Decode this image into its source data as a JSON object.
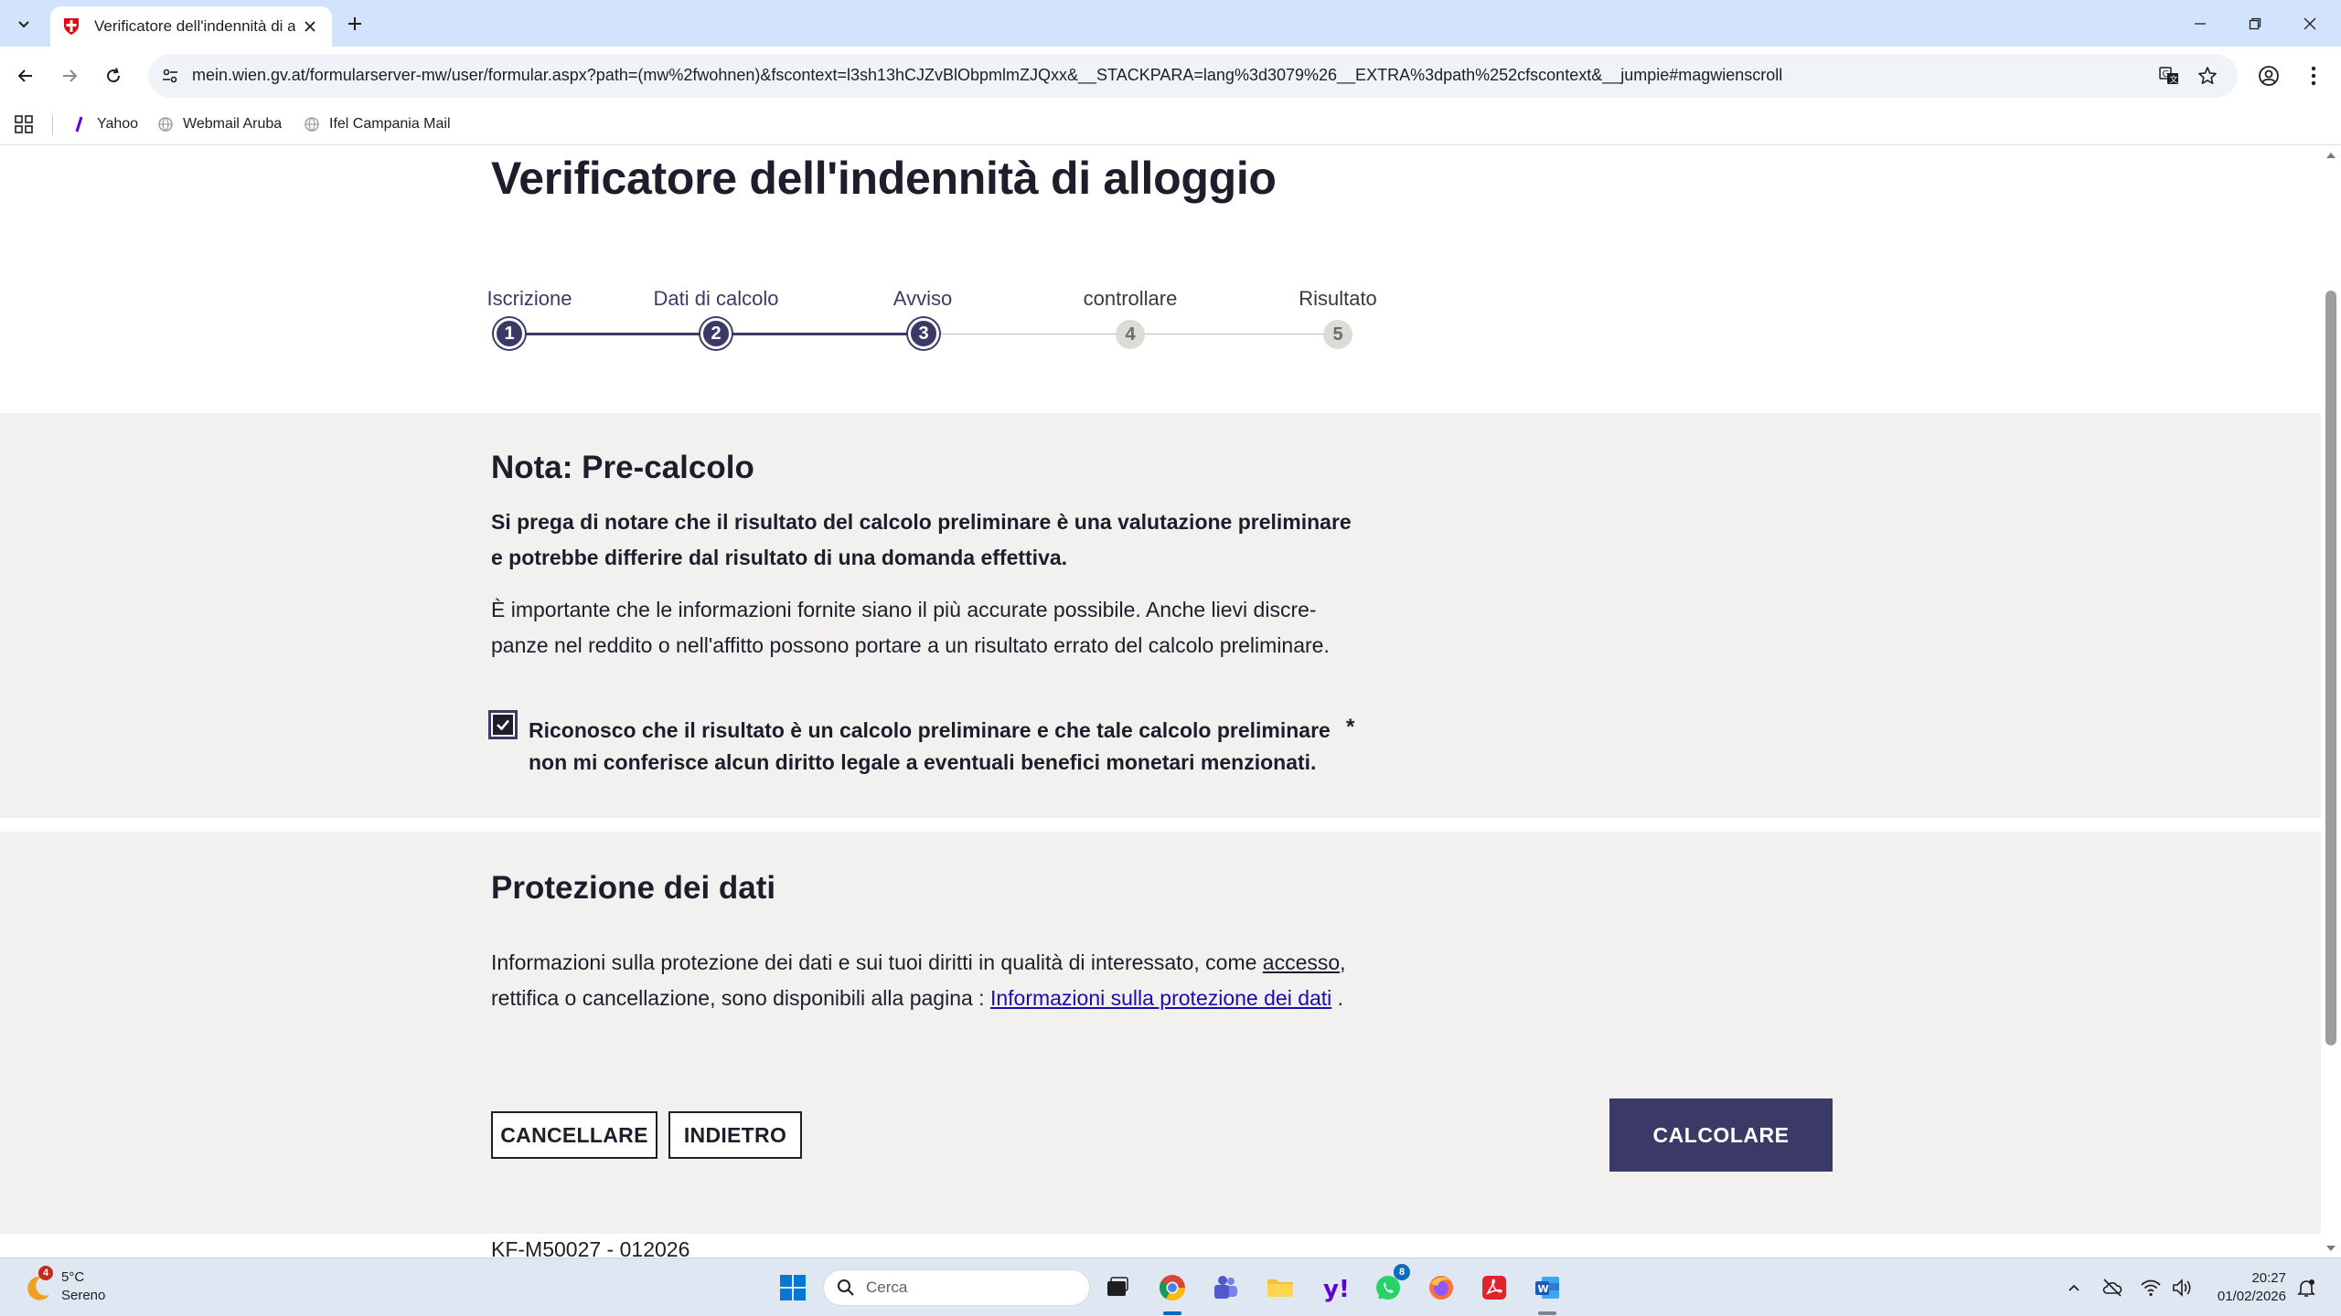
{
  "browser": {
    "tab_title": "Verificatore dell'indennità di all",
    "url": "mein.wien.gv.at/formularserver-mw/user/formular.aspx?path=(mw%2fwohnen)&fscontext=l3sh13hCJZvBlObpmlmZJQxx&__STACKPARA=lang%3d3079%26__EXTRA%3dpath%252cfscontext&__jumpie#magwienscroll",
    "bookmarks": [
      "Yahoo",
      "Webmail Aruba",
      "Ifel Campania Mail"
    ]
  },
  "page": {
    "title": "Verificatore dell'indennità di alloggio",
    "steps": [
      {
        "label": "Iscrizione",
        "number": "1",
        "state": "done"
      },
      {
        "label": "Dati di calcolo",
        "number": "2",
        "state": "done"
      },
      {
        "label": "Avviso",
        "number": "3",
        "state": "current"
      },
      {
        "label": "controllare",
        "number": "4",
        "state": "todo"
      },
      {
        "label": "Risultato",
        "number": "5",
        "state": "todo"
      }
    ],
    "note": {
      "heading": "Nota: Pre-calcolo",
      "bold_text": "Si prega di notare che il risultato del calcolo preliminare è una valutazione preliminare e potrebbe differire dal risultato di una domanda effettiva.",
      "text": "È importante che le informazioni fornite siano il più accurate possibile. Anche lievi discre-panze nel reddito o nell'affitto possono portare a un risultato errato del calcolo preliminare.",
      "checkbox_label": "Riconosco che il risultato è un calcolo preliminare e che tale calcolo preliminare non mi conferisce alcun diritto legale a eventuali benefici monetari menzionati.",
      "checkbox_checked": true,
      "required_mark": "*"
    },
    "privacy": {
      "heading": "Protezione dei dati",
      "text_before": "Informazioni sulla protezione dei dati e sui tuoi diritti in qualità di interessato, come ",
      "access_word": "accesso",
      "text_middle": ", rettifica o cancellazione, sono disponibili alla pagina : ",
      "link_text": "Informazioni sulla protezione dei dati",
      "text_after": " ."
    },
    "buttons": {
      "cancel": "CANCELLARE",
      "back": "INDIETRO",
      "calculate": "CALCOLARE"
    },
    "form_code": "KF-M50027 - 012026"
  },
  "taskbar": {
    "weather_temp": "5°C",
    "weather_condition": "Sereno",
    "weather_badge": "4",
    "search_placeholder": "Cerca",
    "whatsapp_badge": "8",
    "time": "20:27",
    "date": "01/02/2026"
  },
  "colors": {
    "accent": "#3b3a67",
    "gray_section": "#f2f1ef",
    "tabstrip": "#d3e3fd"
  }
}
